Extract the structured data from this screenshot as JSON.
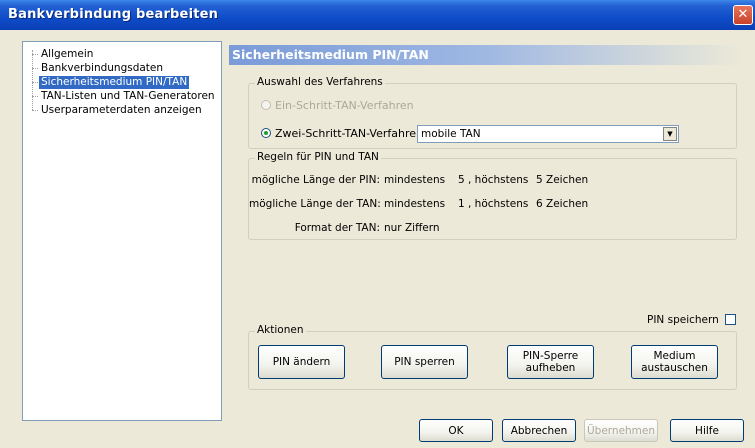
{
  "window": {
    "title": "Bankverbindung bearbeiten",
    "close_glyph": "✕"
  },
  "nav": {
    "items": [
      {
        "label": "Allgemein",
        "selected": false
      },
      {
        "label": "Bankverbindungsdaten",
        "selected": false
      },
      {
        "label": "Sicherheitsmedium PIN/TAN",
        "selected": true
      },
      {
        "label": "TAN-Listen und TAN-Generatoren",
        "selected": false
      },
      {
        "label": "Userparameterdaten anzeigen",
        "selected": false
      }
    ]
  },
  "section": {
    "title": "Sicherheitsmedium PIN/TAN"
  },
  "verfahren": {
    "group_label": "Auswahl des Verfahrens",
    "option1": "Ein-Schritt-TAN-Verfahren",
    "option2": "Zwei-Schritt-TAN-Verfahren",
    "selected_value": "mobile TAN",
    "selected_option": 2
  },
  "regeln": {
    "group_label": "Regeln für PIN und TAN",
    "pin_label": "mögliche Länge der PIN:",
    "pin_min_label": "mindestens",
    "pin_min": "5",
    "pin_max_label": ", höchstens",
    "pin_max": "5",
    "pin_unit": "Zeichen",
    "tan_label": "mögliche Länge der TAN:",
    "tan_min_label": "mindestens",
    "tan_min": "1",
    "tan_max_label": ", höchstens",
    "tan_max": "6",
    "tan_unit": "Zeichen",
    "format_label": "Format der TAN:",
    "format_value": "nur Ziffern"
  },
  "pin_save": {
    "label": "PIN speichern",
    "checked": false
  },
  "aktionen": {
    "group_label": "Aktionen",
    "change_pin": "PIN ändern",
    "lock_pin": "PIN sperren",
    "unlock_pin": "PIN-Sperre\naufheben",
    "replace_medium": "Medium\naustauschen"
  },
  "footer": {
    "ok": "OK",
    "cancel": "Abbrechen",
    "apply": "Übernehmen",
    "help": "Hilfe"
  },
  "colors": {
    "titlebar": "#0f4cc8",
    "selection": "#316ac5",
    "radio_dot": "#21a121"
  }
}
